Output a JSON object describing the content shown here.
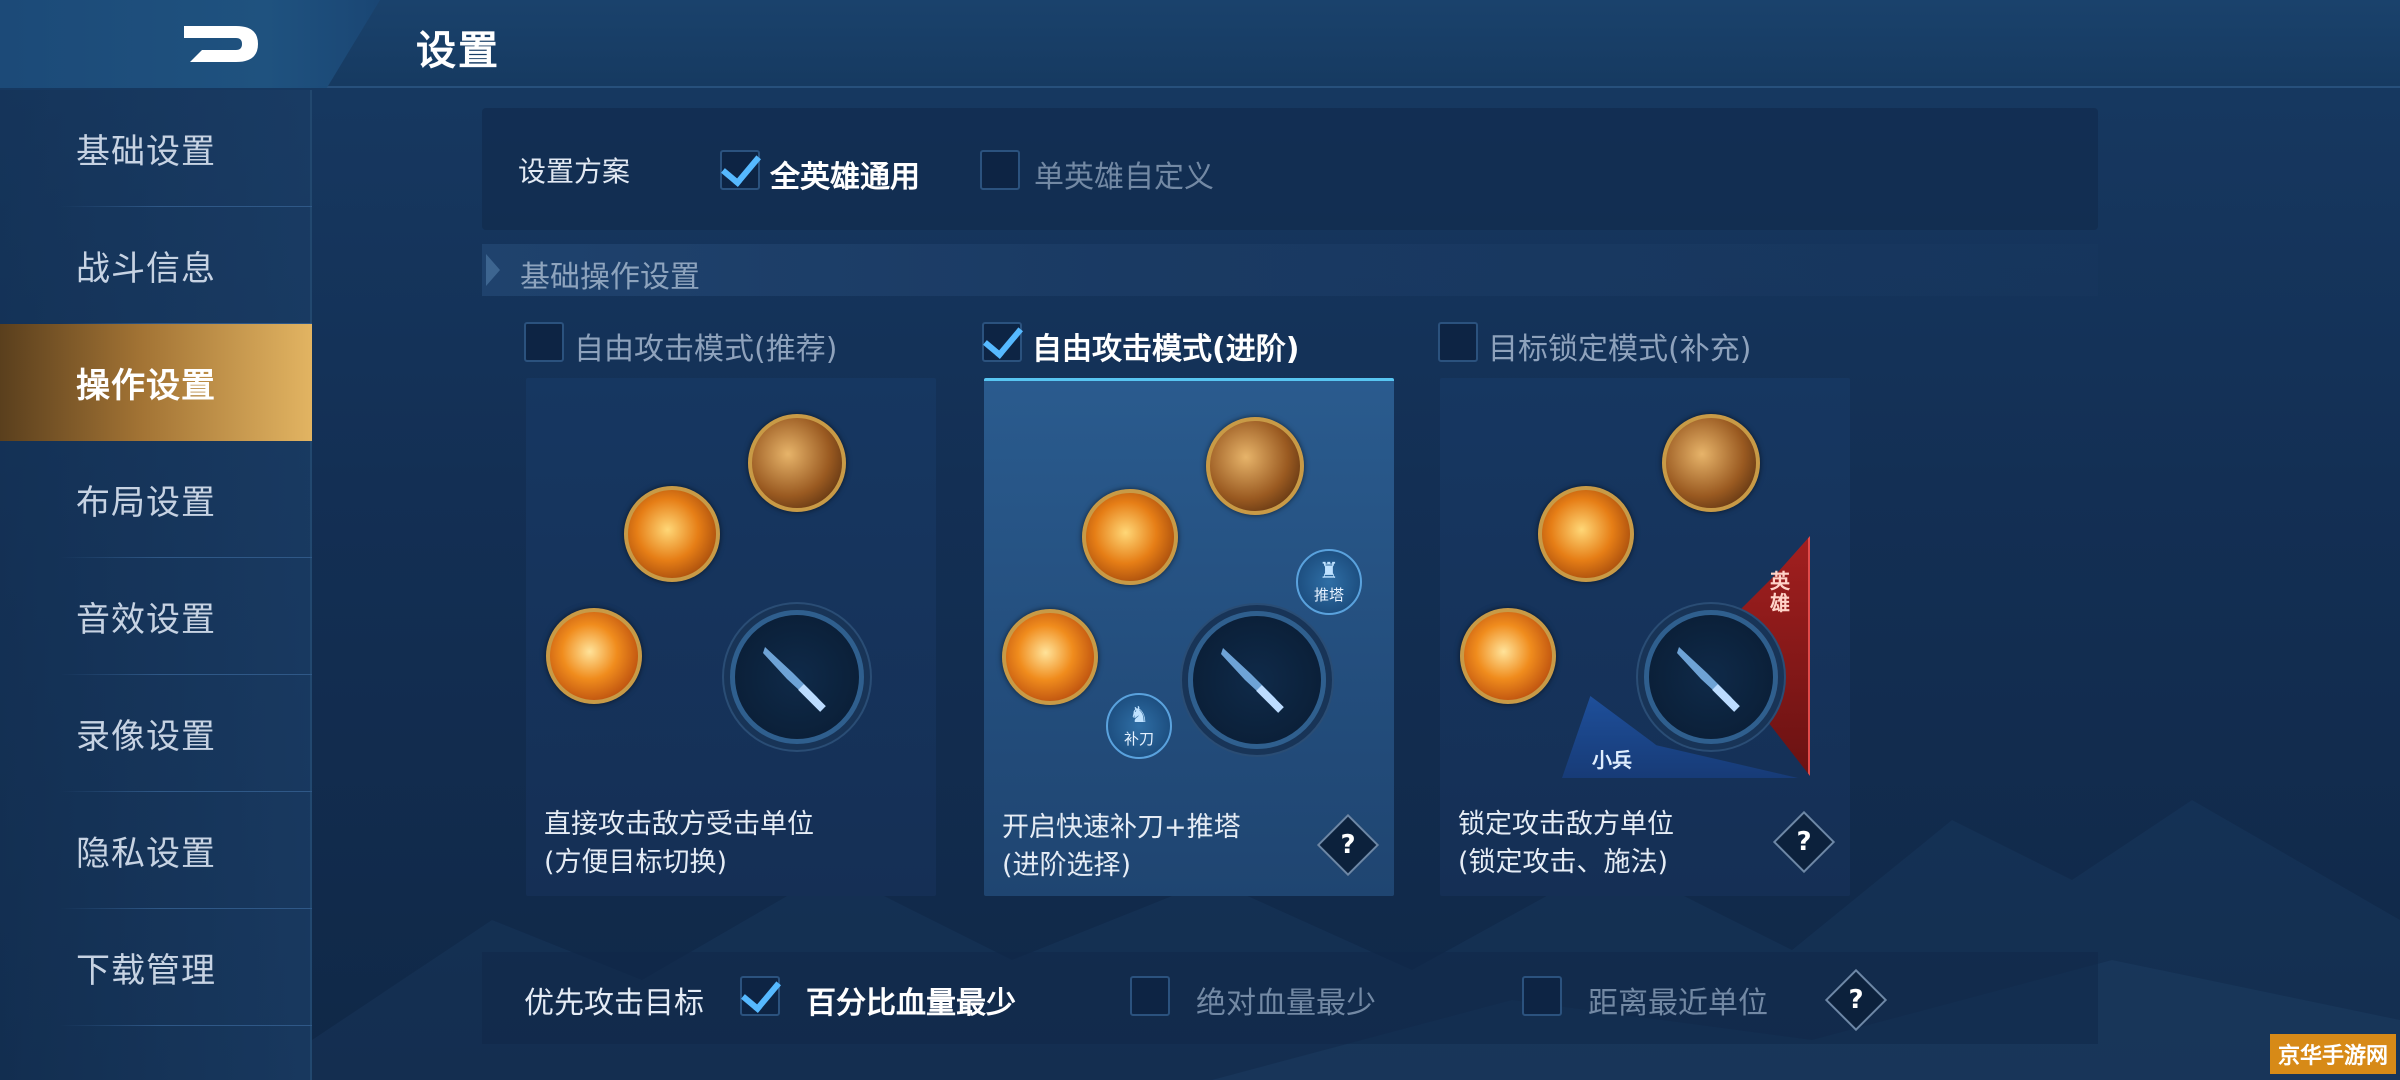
{
  "header": {
    "title": "设置"
  },
  "sidebar": {
    "items": [
      {
        "label": "基础设置",
        "active": false
      },
      {
        "label": "战斗信息",
        "active": false
      },
      {
        "label": "操作设置",
        "active": true
      },
      {
        "label": "布局设置",
        "active": false
      },
      {
        "label": "音效设置",
        "active": false
      },
      {
        "label": "录像设置",
        "active": false
      },
      {
        "label": "隐私设置",
        "active": false
      },
      {
        "label": "下载管理",
        "active": false
      }
    ]
  },
  "scheme": {
    "label": "设置方案",
    "options": [
      {
        "label": "全英雄通用",
        "checked": true
      },
      {
        "label": "单英雄自定义",
        "checked": false
      }
    ]
  },
  "section": {
    "title": "基础操作设置"
  },
  "modes": [
    {
      "label": "自由攻击模式(推荐)",
      "checked": false,
      "desc_line1": "直接攻击敌方受击单位",
      "desc_line2": "(方便目标切换)"
    },
    {
      "label": "自由攻击模式(进阶)",
      "checked": true,
      "desc_line1": "开启快速补刀+推塔",
      "desc_line2": "(进阶选择)",
      "mini_push": "推塔",
      "mini_lasthit": "补刀"
    },
    {
      "label": "目标锁定模式(补充)",
      "checked": false,
      "desc_line1": "锁定攻击敌方单位",
      "desc_line2": "(锁定攻击、施法)",
      "hero_label": "英雄",
      "minion_label": "小兵"
    }
  ],
  "priority": {
    "label": "优先攻击目标",
    "options": [
      {
        "label": "百分比血量最少",
        "checked": true
      },
      {
        "label": "绝对血量最少",
        "checked": false
      },
      {
        "label": "距离最近单位",
        "checked": false
      }
    ]
  },
  "help_label": "?",
  "watermark": "京华手游网"
}
